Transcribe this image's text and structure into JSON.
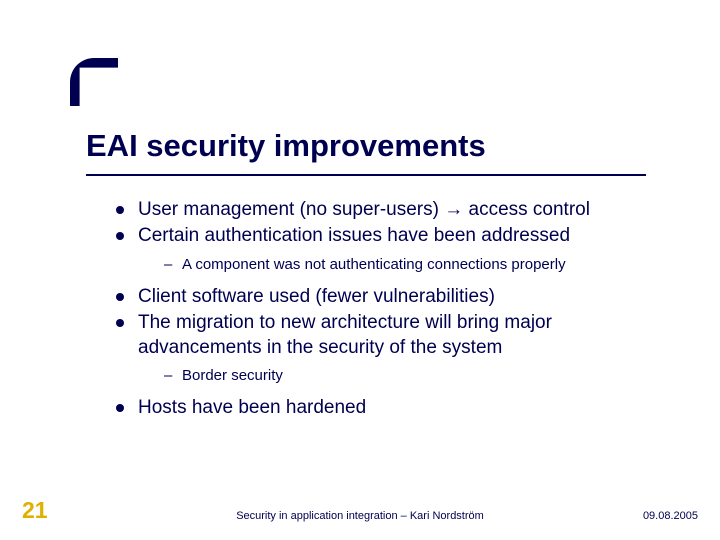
{
  "title": "EAI security improvements",
  "bullets": [
    {
      "text": "User management (no super-users) → access control"
    },
    {
      "text": "Certain authentication issues have been addressed",
      "sub": [
        {
          "text": "A component was not authenticating connections properly"
        }
      ]
    },
    {
      "text": "Client software used (fewer vulnerabilities)"
    },
    {
      "text": "The migration to new architecture will bring major advancements in the security of the system",
      "sub": [
        {
          "text": "Border security"
        }
      ]
    },
    {
      "text": "Hosts have been hardened"
    }
  ],
  "page_number": "21",
  "footer_center": "Security in application integration – Kari Nordström",
  "footer_right": "09.08.2005"
}
